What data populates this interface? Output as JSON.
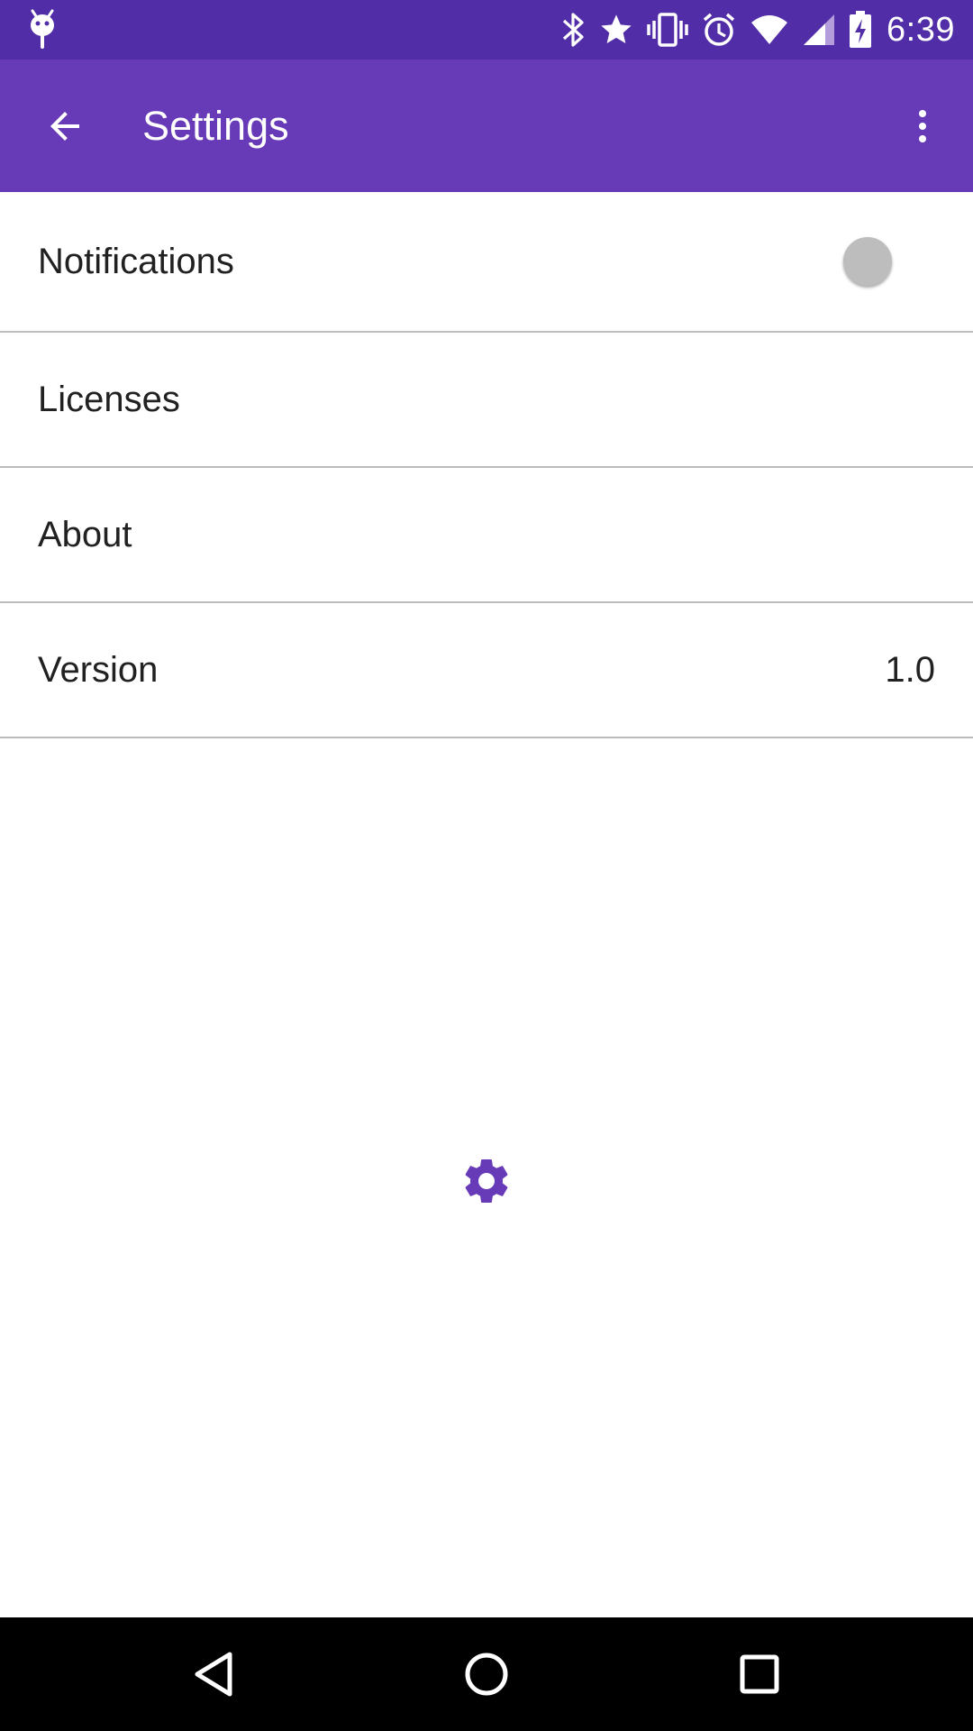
{
  "status_bar": {
    "time": "6:39",
    "icons": [
      "android-debug-icon",
      "bluetooth-icon",
      "star-icon",
      "vibrate-icon",
      "alarm-icon",
      "wifi-icon",
      "cell-signal-icon",
      "battery-charging-icon"
    ]
  },
  "app_bar": {
    "title": "Settings",
    "back_icon": "arrow-back-icon",
    "overflow_icon": "more-vert-icon",
    "color": "#673AB7",
    "status_color": "#512DA8"
  },
  "settings": {
    "notifications": {
      "label": "Notifications",
      "enabled": false
    },
    "licenses": {
      "label": "Licenses"
    },
    "about": {
      "label": "About"
    },
    "version": {
      "label": "Version",
      "value": "1.0"
    }
  },
  "center_icon": {
    "name": "gear-icon",
    "color": "#673AB7"
  },
  "nav_bar": {
    "buttons": [
      "back-triangle-icon",
      "home-circle-icon",
      "recents-square-icon"
    ]
  }
}
